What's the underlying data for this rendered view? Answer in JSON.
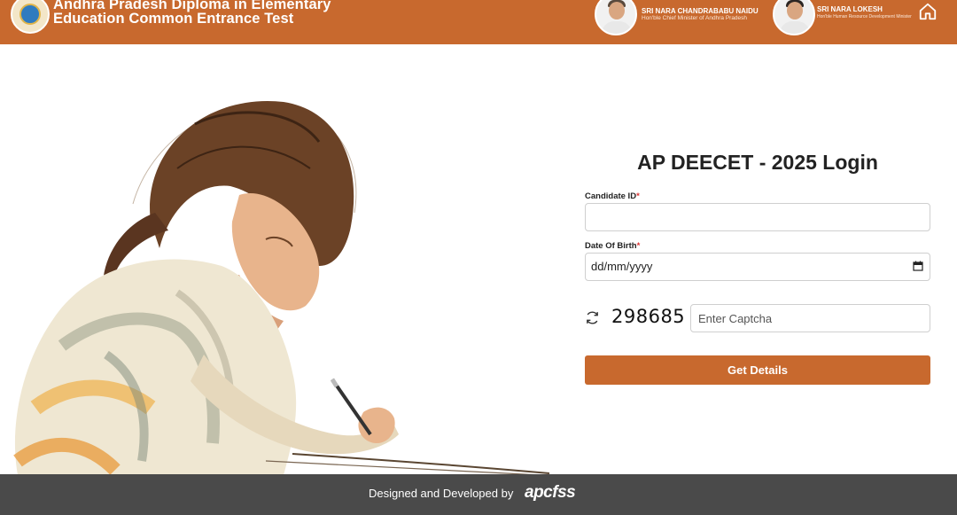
{
  "header": {
    "title_line1": "Andhra Pradesh Diploma in Elementary",
    "title_line2": "Education Common Entrance Test",
    "people": [
      {
        "name": "SRI NARA CHANDRABABU NAIDU",
        "role": "Hon'ble Chief Minister of Andhra Pradesh"
      },
      {
        "name": "SRI NARA LOKESH",
        "role": "Hon'ble Human Resource Development Minister"
      }
    ],
    "home_icon": "home-icon"
  },
  "login": {
    "title": "AP DEECET - 2025 Login",
    "candidate_id_label": "Candidate ID",
    "candidate_id_value": "",
    "required_mark": "*",
    "dob_label": "Date Of Birth",
    "dob_placeholder": "dd/mm/yyyy",
    "captcha_code": "298685",
    "captcha_placeholder": "Enter Captcha",
    "submit_label": "Get Details"
  },
  "footer": {
    "text": "Designed and Developed by",
    "brand": "apcfss"
  },
  "colors": {
    "accent": "#c8692e",
    "footer_bg": "#4a4a4a"
  }
}
